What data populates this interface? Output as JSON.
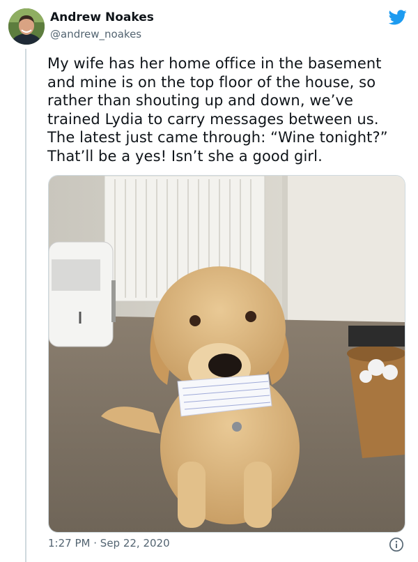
{
  "tweet": {
    "author_name": "Andrew Noakes",
    "author_handle": "@andrew_noakes",
    "text": "My wife has her home office in the basement and mine is on the top floor of the house, so rather than shouting up and down, we’ve trained Lydia to carry messages between us. The latest just came through: “Wine tonight?” That’ll be a yes! Isn’t she a good girl.",
    "time": "1:27 PM",
    "separator": "·",
    "date": "Sep 22, 2020"
  },
  "icons": {
    "brand": "twitter-bird-icon",
    "info": "info-icon"
  },
  "colors": {
    "brand_blue": "#1d9bf0",
    "text": "#0f1419",
    "secondary": "#536471"
  }
}
